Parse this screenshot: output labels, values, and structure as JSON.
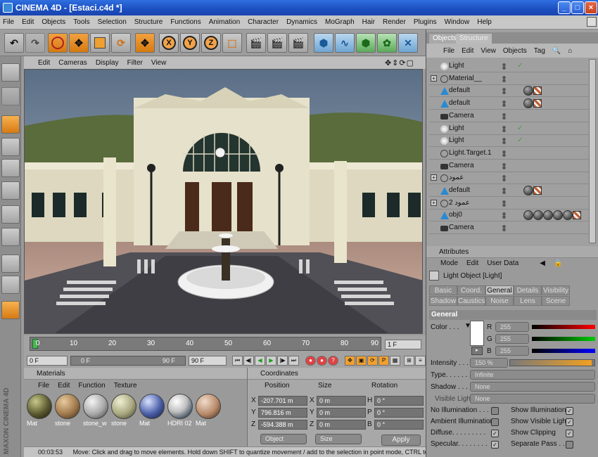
{
  "window": {
    "title": "CINEMA 4D - [Estaci.c4d *]",
    "minimize": "_",
    "maximize": "□",
    "close": "×"
  },
  "menubar": [
    "File",
    "Edit",
    "Objects",
    "Tools",
    "Selection",
    "Structure",
    "Functions",
    "Animation",
    "Character",
    "Dynamics",
    "MoGraph",
    "Hair",
    "Render",
    "Plugins",
    "Window",
    "Help"
  ],
  "toolbar": {
    "x_axis": "X",
    "y_axis": "Y",
    "z_axis": "Z"
  },
  "viewport": {
    "menu": [
      "Edit",
      "Cameras",
      "Display",
      "Filter",
      "View"
    ],
    "nav": "✥⇕⟳▢"
  },
  "timeline": {
    "ticks": [
      "0",
      "10",
      "20",
      "30",
      "40",
      "50",
      "60",
      "70",
      "80",
      "90"
    ],
    "current_frame": "1 F",
    "start_field": "0 F",
    "range_start": "0 F",
    "range_end": "90 F",
    "end_field": "90 F"
  },
  "materials": {
    "title": "Materials",
    "menu": [
      "File",
      "Edit",
      "Function",
      "Texture"
    ],
    "items": [
      {
        "name": "Mat",
        "color": "radial-gradient(circle at 35% 30%,#c8c88a,#5a5a30 55%,#141408)"
      },
      {
        "name": "stone",
        "color": "radial-gradient(circle at 35% 30%,#e8c99c,#a07a4c 55%,#3c2814)"
      },
      {
        "name": "stone_w",
        "color": "radial-gradient(circle at 35% 30%,#f4f4f4,#a8a8a8 55%,#3a3a3a)"
      },
      {
        "name": "stone",
        "color": "radial-gradient(circle at 35% 30%,#f0efd2,#a8a780 55%,#3e3d24)"
      },
      {
        "name": "Mat",
        "color": "radial-gradient(circle at 35% 30%,#d8e2ff,#4a5ea8 55%,#101830)"
      },
      {
        "name": "HDRI 02",
        "color": "radial-gradient(circle at 35% 30%,#ffffff,#c0c0c0 45%,#405060 80%)"
      },
      {
        "name": "Mat",
        "color": "radial-gradient(circle at 35% 30%,#f0dccb,#b98a6a 55%,#3a2415)"
      }
    ]
  },
  "coordinates": {
    "title": "Coordinates",
    "headers": [
      "Position",
      "Size",
      "Rotation"
    ],
    "rows": [
      {
        "axis": "X",
        "pos": "-207.701 m",
        "s_axis": "X",
        "size": "0 m",
        "r_axis": "H",
        "rot": "0 °"
      },
      {
        "axis": "Y",
        "pos": "796.816 m",
        "s_axis": "Y",
        "size": "0 m",
        "r_axis": "P",
        "rot": "0 °"
      },
      {
        "axis": "Z",
        "pos": "-594.388 m",
        "s_axis": "Z",
        "size": "0 m",
        "r_axis": "B",
        "rot": "0 °"
      }
    ],
    "mode1": "Object",
    "mode2": "Size",
    "apply": "Apply"
  },
  "statusbar": {
    "time": "00:03:53",
    "message": "Move: Click and drag to move elements. Hold down SHIFT to quantize movement / add to the selection in point mode, CTRL to remove."
  },
  "objects": {
    "tabs": [
      "Objects",
      "Structure"
    ],
    "menu": [
      "File",
      "Edit",
      "View",
      "Objects",
      "Tag"
    ],
    "rows": [
      {
        "name": "Light",
        "type": "light",
        "expand": false,
        "check": "✓",
        "tags": []
      },
      {
        "name": "Material__",
        "type": "null",
        "expand": true,
        "check": "",
        "tags": []
      },
      {
        "name": "default",
        "type": "poly",
        "expand": false,
        "check": "",
        "tags": [
          "ball",
          "sq"
        ]
      },
      {
        "name": "default",
        "type": "poly",
        "expand": false,
        "check": "",
        "tags": [
          "ball",
          "sq"
        ]
      },
      {
        "name": "Camera",
        "type": "camera",
        "expand": false,
        "check": "",
        "tags": []
      },
      {
        "name": "Light",
        "type": "light",
        "expand": false,
        "check": "✓",
        "tags": []
      },
      {
        "name": "Light",
        "type": "light",
        "expand": false,
        "check": "✓",
        "tags": []
      },
      {
        "name": "Light.Target.1",
        "type": "null",
        "expand": false,
        "check": "",
        "tags": []
      },
      {
        "name": "Camera",
        "type": "camera",
        "expand": false,
        "check": "",
        "tags": []
      },
      {
        "name": "عمود",
        "type": "null",
        "expand": true,
        "check": "",
        "tags": []
      },
      {
        "name": "default",
        "type": "poly",
        "expand": false,
        "check": "",
        "tags": [
          "ball",
          "sq"
        ]
      },
      {
        "name": "عمود 2",
        "type": "null",
        "expand": true,
        "check": "",
        "tags": []
      },
      {
        "name": "obj0",
        "type": "poly",
        "expand": false,
        "check": "",
        "tags": [
          "ball",
          "ball",
          "ball",
          "ball",
          "ball",
          "sq"
        ]
      },
      {
        "name": "Camera",
        "type": "camera",
        "expand": false,
        "check": "",
        "tags": []
      }
    ]
  },
  "attributes": {
    "title": "Attributes",
    "menu": [
      "Mode",
      "Edit",
      "User Data"
    ],
    "object_label": "Light Object [Light]",
    "tabs_row1": [
      "Basic",
      "Coord.",
      "General",
      "Details",
      "Visibility"
    ],
    "tabs_row2": [
      "Shadow",
      "Caustics",
      "Noise",
      "Lens",
      "Scene"
    ],
    "section": "General",
    "color_label": "Color . . .",
    "r_label": "R",
    "r_value": "255",
    "g_label": "G",
    "g_value": "255",
    "b_label": "B",
    "b_value": "255",
    "intensity_label": "Intensity . . . .",
    "intensity_value": "150 %",
    "intensity_level": 0.97,
    "type_label": "Type. . . . . . . .",
    "type_value": "Infinite",
    "shadow_label": "Shadow . . . .",
    "shadow_value": "None",
    "visible_light_label": "Visible Light",
    "visible_light_value": "None",
    "checks": [
      {
        "label": "No Illumination . . .",
        "on": false
      },
      {
        "label": "Show Illumination",
        "on": true
      },
      {
        "label": "Ambient Illumination",
        "on": false
      },
      {
        "label": "Show Visible Light",
        "on": true
      },
      {
        "label": "Diffuse. . . . . . . . .",
        "on": true
      },
      {
        "label": "Show Clipping",
        "on": true
      },
      {
        "label": "Specular. . . . . . . .",
        "on": true
      },
      {
        "label": "Separate Pass . .",
        "on": false
      }
    ]
  },
  "branding": "MAXON CINEMA 4D",
  "colors": {
    "title_blue": "#1c4fc0",
    "accent_orange": "#e58a1f",
    "panel_grey": "#9d9d9d"
  }
}
